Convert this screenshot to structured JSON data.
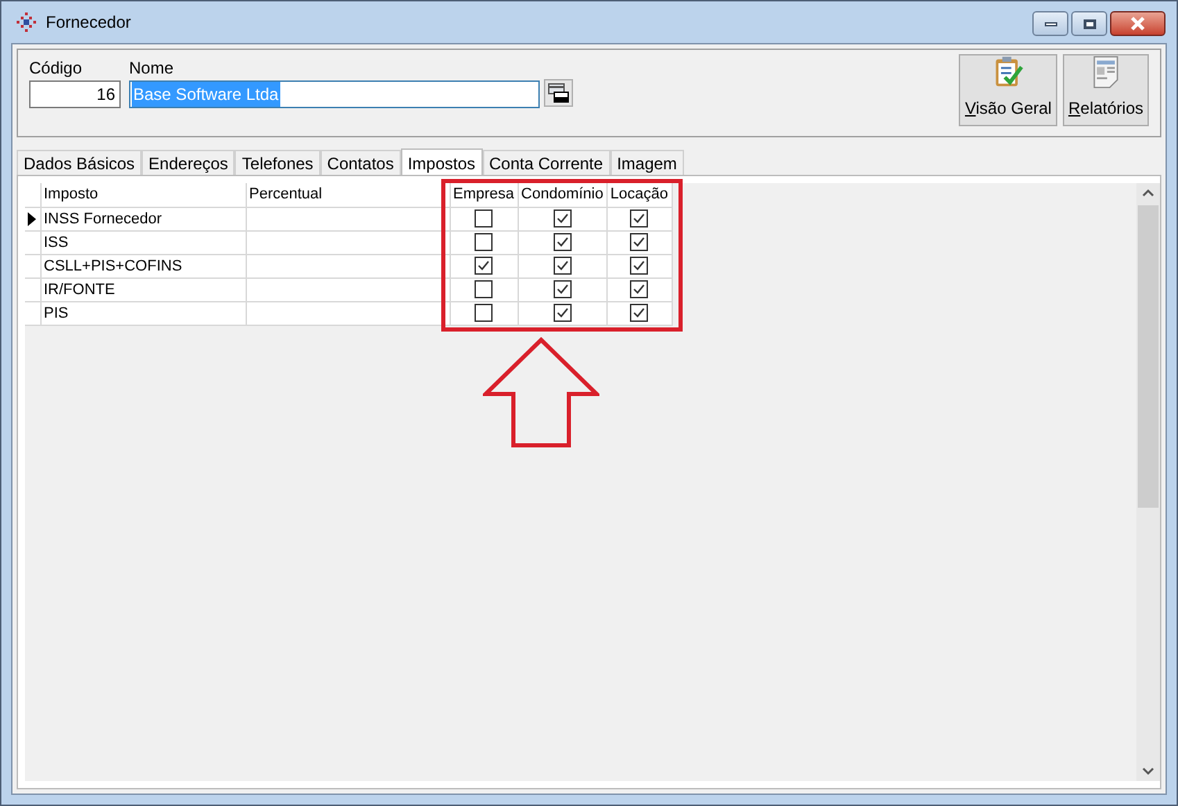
{
  "window": {
    "title": "Fornecedor"
  },
  "header": {
    "codigo": {
      "label": "Código",
      "value": "16"
    },
    "nome": {
      "label": "Nome",
      "value": "Base Software Ltda",
      "selected": true
    }
  },
  "buttons": [
    {
      "label": "Visão Geral",
      "kind": "overview"
    },
    {
      "label": "Relatórios",
      "kind": "reports"
    }
  ],
  "tabs": [
    {
      "label": "Dados Básicos",
      "selected": false
    },
    {
      "label": "Endereços",
      "selected": false
    },
    {
      "label": "Telefones",
      "selected": false
    },
    {
      "label": "Contatos",
      "selected": false
    },
    {
      "label": "Impostos",
      "selected": true
    },
    {
      "label": "Conta Corrente",
      "selected": false
    },
    {
      "label": "Imagem",
      "selected": false
    }
  ],
  "table": {
    "columns": [
      "Imposto",
      "Percentual",
      "Empresa",
      "Condomínio",
      "Locação"
    ],
    "rows": [
      {
        "imposto": "INSS Fornecedor",
        "current": true,
        "empresa": false,
        "condominio": true,
        "locacao": true
      },
      {
        "imposto": "ISS",
        "current": false,
        "empresa": false,
        "condominio": true,
        "locacao": true
      },
      {
        "imposto": "CSLL+PIS+COFINS",
        "current": false,
        "empresa": true,
        "condominio": true,
        "locacao": true
      },
      {
        "imposto": "IR/FONTE",
        "current": false,
        "empresa": false,
        "condominio": true,
        "locacao": true
      },
      {
        "imposto": "PIS",
        "current": false,
        "empresa": false,
        "condominio": true,
        "locacao": true
      }
    ]
  }
}
